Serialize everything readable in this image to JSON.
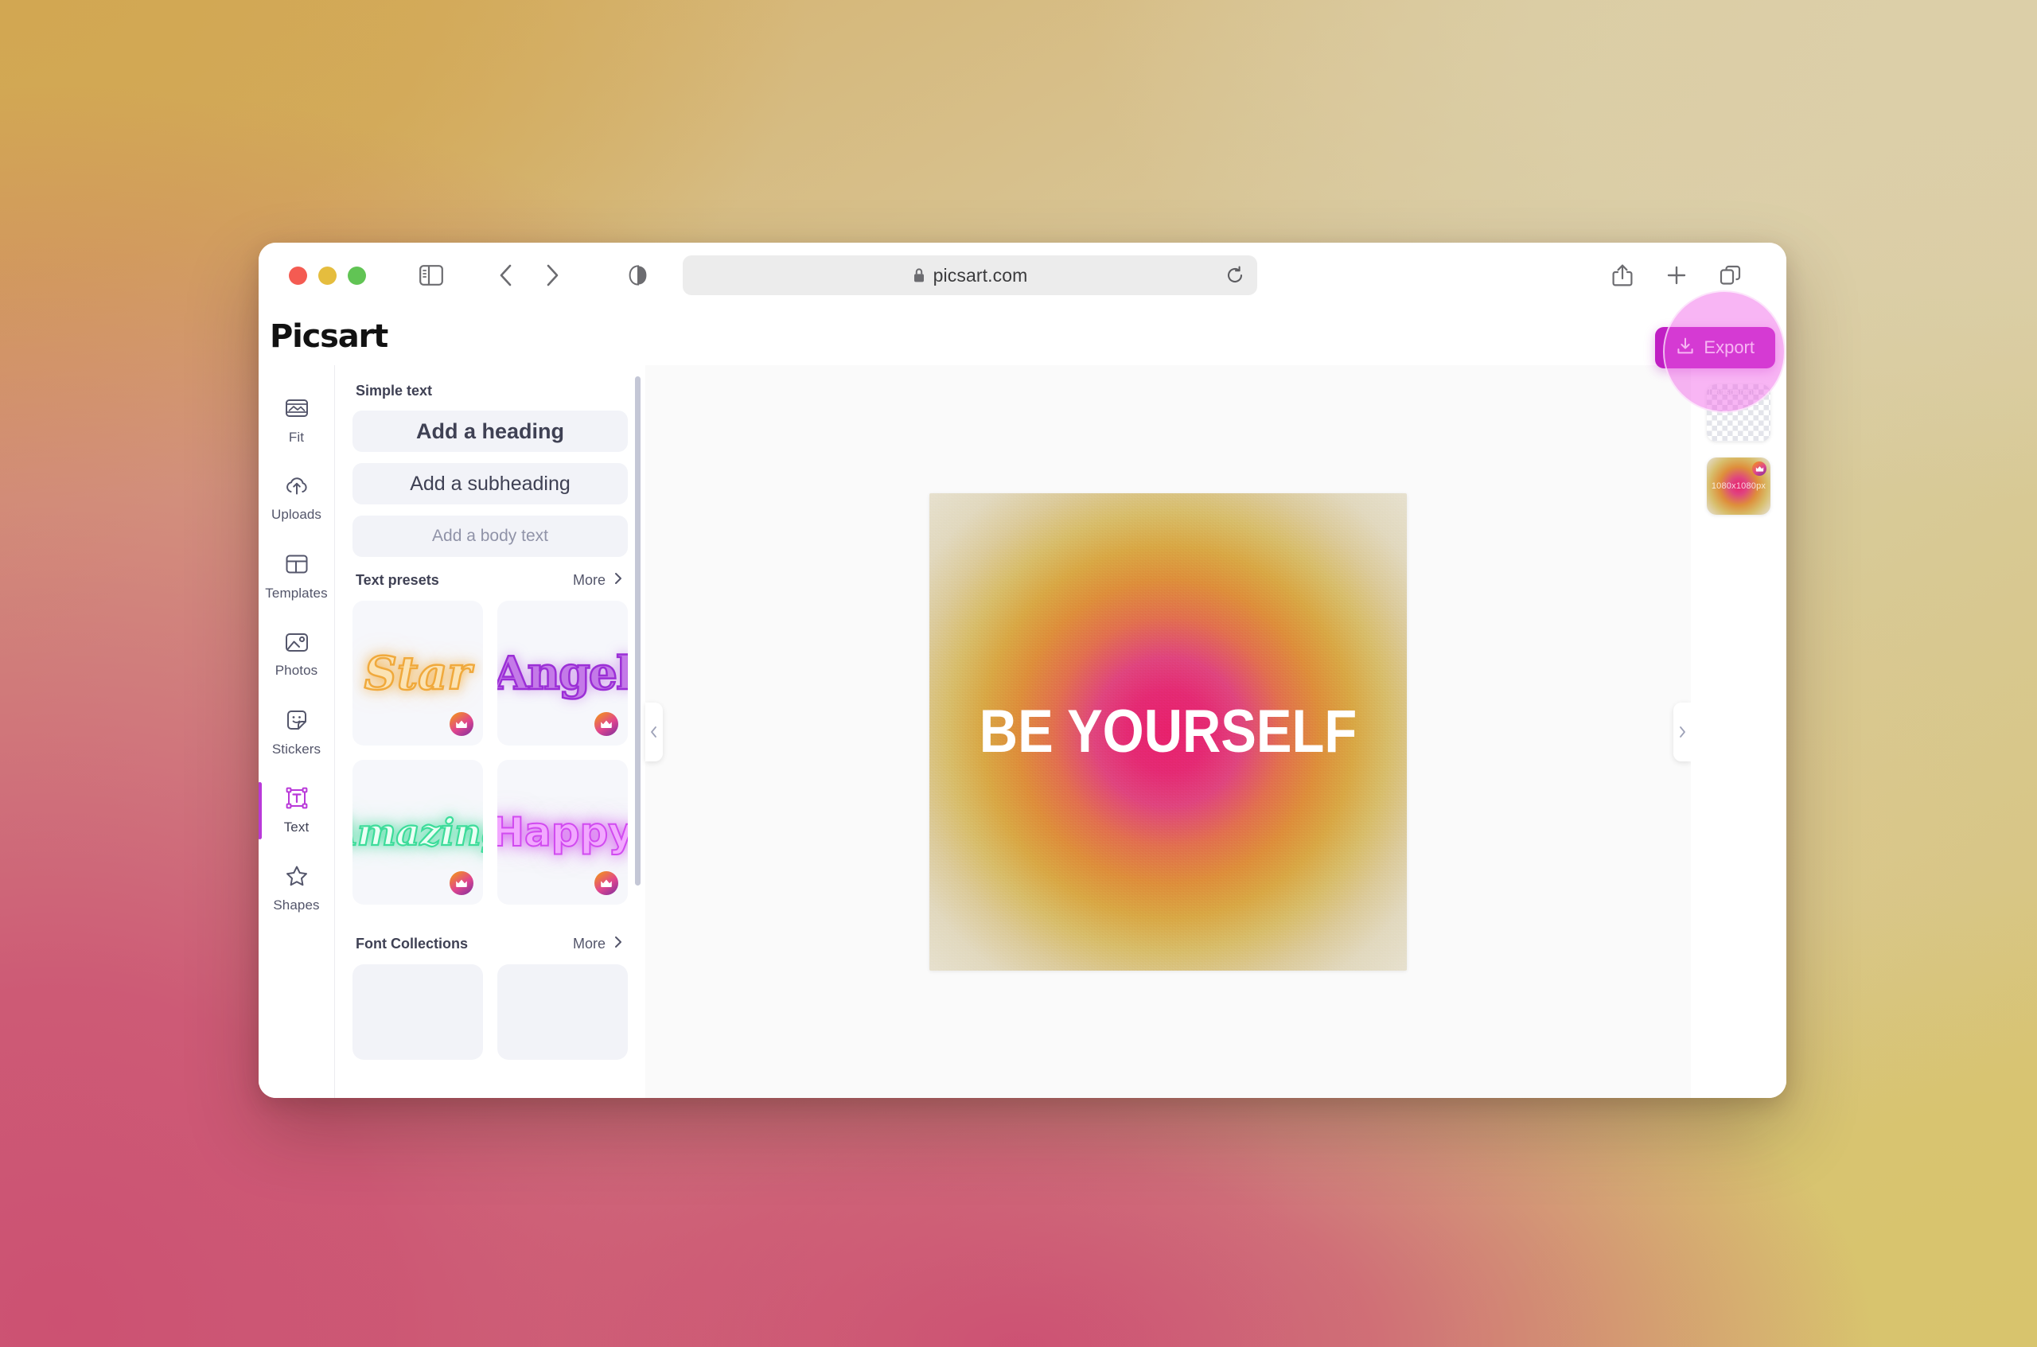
{
  "browser": {
    "window_controls": [
      "close",
      "minimize",
      "maximize"
    ],
    "sidebar_toggle_icon": "sidebar-icon",
    "back_icon": "chevron-left-icon",
    "forward_icon": "chevron-right-icon",
    "reader_icon": "reader-view-icon",
    "address": {
      "lock_icon": "lock-icon",
      "url": "picsart.com",
      "reload_icon": "reload-icon"
    },
    "toolbar_right": [
      {
        "name": "share-icon",
        "label": "Share"
      },
      {
        "name": "new-tab-icon",
        "label": "New Tab"
      },
      {
        "name": "tab-overview-icon",
        "label": "Tab Overview"
      }
    ]
  },
  "app": {
    "brand": "Picsart",
    "export": {
      "label": "Export",
      "icon": "download-icon",
      "color": "#c01fc4"
    },
    "tool_rail": [
      {
        "id": "fit",
        "label": "Fit",
        "icon": "fit-image-icon",
        "active": false
      },
      {
        "id": "uploads",
        "label": "Uploads",
        "icon": "upload-cloud-icon",
        "active": false
      },
      {
        "id": "templates",
        "label": "Templates",
        "icon": "templates-grid-icon",
        "active": false
      },
      {
        "id": "photos",
        "label": "Photos",
        "icon": "photo-icon",
        "active": false
      },
      {
        "id": "stickers",
        "label": "Stickers",
        "icon": "sticker-icon",
        "active": false
      },
      {
        "id": "text",
        "label": "Text",
        "icon": "text-box-icon",
        "active": true
      },
      {
        "id": "shapes",
        "label": "Shapes",
        "icon": "star-shape-icon",
        "active": false
      }
    ],
    "panel": {
      "simple_text": {
        "title": "Simple text",
        "heading": "Add a heading",
        "subheading": "Add a subheading",
        "body": "Add a body text"
      },
      "text_presets": {
        "title": "Text presets",
        "more": "More",
        "more_icon": "chevron-right-icon",
        "items": [
          {
            "word": "Star",
            "style": "pw-star",
            "premium": true
          },
          {
            "word": "Angel",
            "style": "pw-angel",
            "premium": true
          },
          {
            "word": "Amazing",
            "style": "pw-amazing",
            "premium": true
          },
          {
            "word": "Happy",
            "style": "pw-happy",
            "premium": true
          }
        ]
      },
      "font_collections": {
        "title": "Font Collections",
        "more": "More",
        "more_icon": "chevron-right-icon"
      }
    },
    "canvas": {
      "text": "BE YOURSELF",
      "text_color": "#ffffff",
      "arrow_left_icon": "chevron-left-icon",
      "arrow_right_icon": "chevron-right-icon",
      "gradient_center": "#e8216d",
      "gradient_mid": "#de8f3b",
      "gradient_edge": "#e7e1cf"
    },
    "layers": [
      {
        "name": "transparent-layer",
        "label": "Transparent",
        "premium": false
      },
      {
        "name": "gradient-layer",
        "label": "1080x1080px",
        "premium": true
      }
    ]
  }
}
